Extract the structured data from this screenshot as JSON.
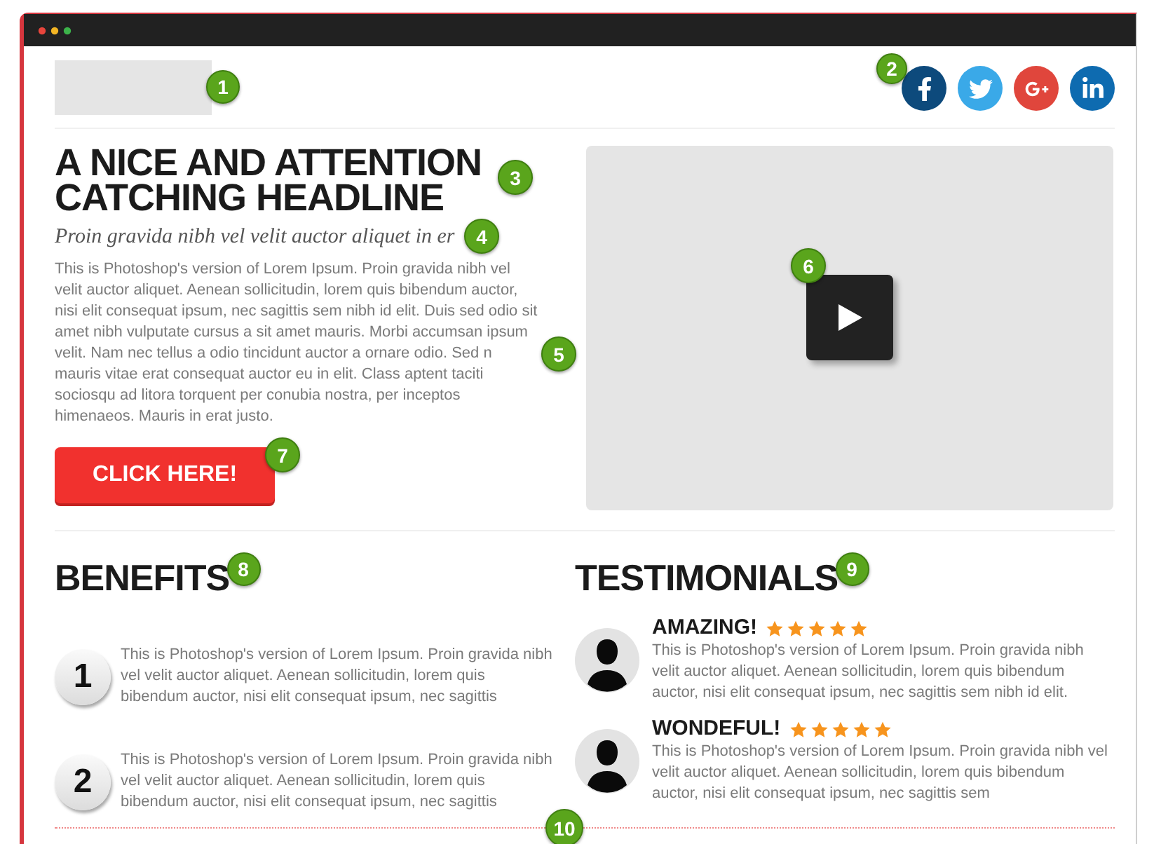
{
  "logo": {
    "badge": "1"
  },
  "social": {
    "badge": "2",
    "icons": [
      {
        "kind": "f"
      },
      {
        "kind": "bird"
      },
      {
        "kind": "gplus"
      },
      {
        "kind": "in"
      }
    ]
  },
  "hero": {
    "headline": "A NICE AND ATTENTION CATCHING HEADLINE",
    "headline_badge": "3",
    "subheadline": "Proin gravida nibh vel velit auctor aliquet in er",
    "subheadline_badge": "4",
    "paragraph": "This is Photoshop's version of Lorem Ipsum. Proin gravida nibh vel velit auctor aliquet. Aenean sollicitudin, lorem quis bibendum auctor, nisi elit consequat ipsum, nec sagittis sem nibh id elit. Duis sed odio sit amet nibh vulputate cursus a sit amet mauris. Morbi accumsan ipsum velit. Nam nec tellus a odio tincidunt auctor a ornare odio. Sed n mauris vitae erat consequat auctor eu in elit. Class aptent taciti sociosqu ad litora torquent per conubia nostra, per inceptos himenaeos. Mauris in erat justo.",
    "paragraph_badge": "5",
    "button": {
      "label": "CLICK HERE!",
      "badge": "7"
    },
    "video": {
      "badge": "6"
    }
  },
  "benefits": {
    "title": "BENEFITS",
    "badge": "8",
    "items": [
      {
        "number": "1",
        "text": "This is Photoshop's version of Lorem Ipsum. Proin gravida nibh vel velit auctor aliquet. Aenean sollicitudin, lorem quis bibendum auctor, nisi elit consequat ipsum, nec sagittis"
      },
      {
        "number": "2",
        "text": "This is Photoshop's version of Lorem Ipsum. Proin gravida nibh vel velit auctor aliquet. Aenean sollicitudin, lorem quis bibendum auctor, nisi elit consequat ipsum, nec sagittis"
      }
    ]
  },
  "testimonials": {
    "title": "TESTIMONIALS",
    "badge": "9",
    "items": [
      {
        "title": "AMAZING!",
        "stars": 5,
        "text": "This is Photoshop's version of Lorem Ipsum. Proin gravida nibh velit auctor aliquet. Aenean sollicitudin, lorem quis bibendum auctor, nisi elit consequat ipsum, nec sagittis sem nibh id elit."
      },
      {
        "title": "WONDEFUL!",
        "stars": 5,
        "text": "This is Photoshop's version of Lorem Ipsum. Proin gravida nibh vel velit auctor aliquet. Aenean sollicitudin, lorem quis bibendum auctor, nisi elit consequat ipsum, nec sagittis sem"
      }
    ]
  },
  "footer_badge": "10"
}
